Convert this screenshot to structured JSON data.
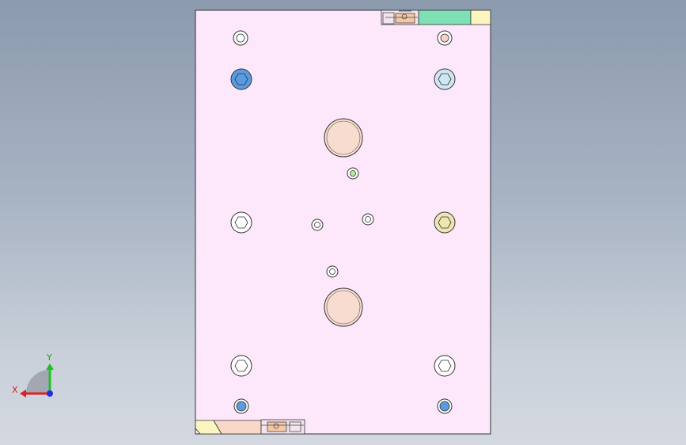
{
  "colors": {
    "background_top": "#8c9aae",
    "background_bottom": "#d4d8e0",
    "plate_fill": "#fde8fb",
    "plate_stroke": "#333333",
    "green_insert": "#7ee0b4",
    "yellow_insert": "#fbf6c0",
    "peach_insert": "#f9d8c8",
    "blue_bolt": "#5a9ade",
    "light_blue_bolt": "#cfe6f3",
    "khaki_bolt": "#eee6b0",
    "pin_fill": "#f9dcd0",
    "axis_x": "#e02020",
    "axis_y": "#20c020",
    "axis_z": "#2030e0"
  },
  "icons": {
    "triad": "coordinate-triad-icon"
  },
  "triad": {
    "x_label": "X",
    "y_label": "Y"
  }
}
